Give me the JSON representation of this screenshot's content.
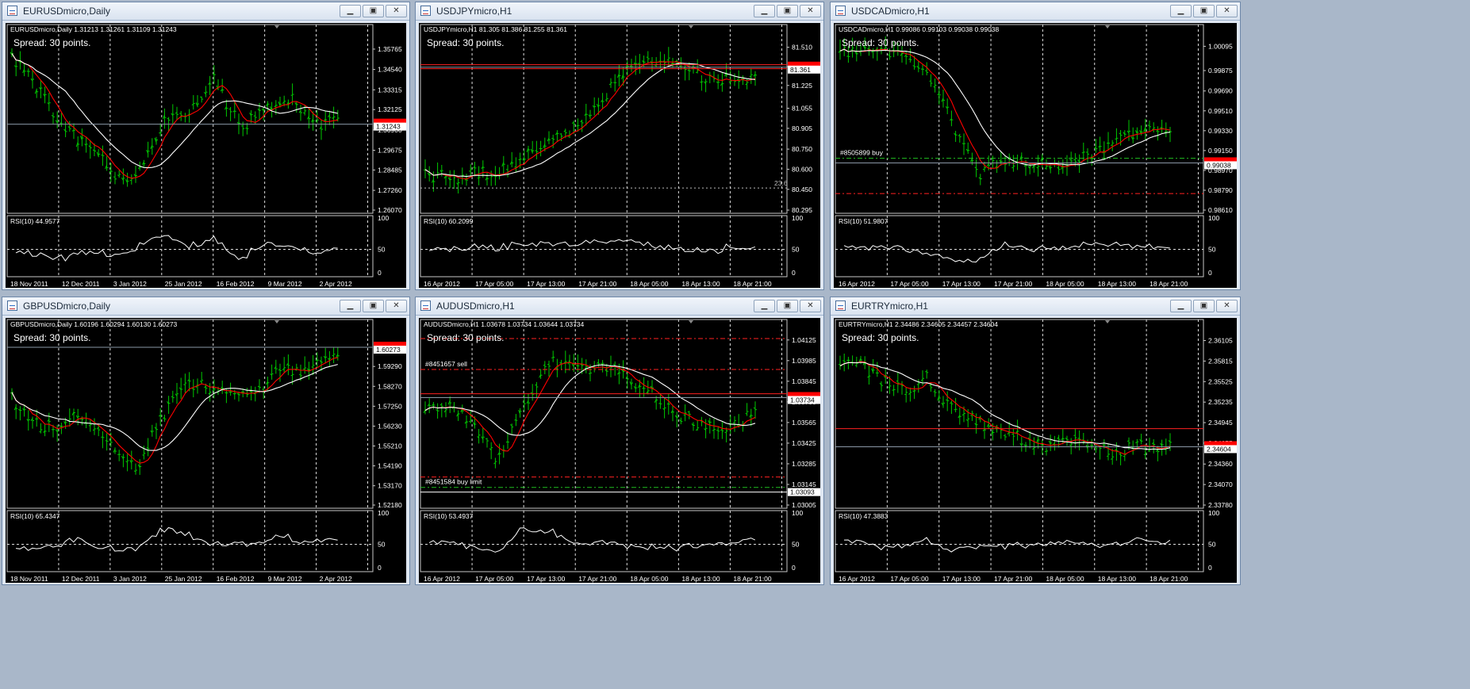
{
  "common": {
    "spread_text": "Spread: 30 points.",
    "rsi_levels": [
      "100",
      "50",
      "0"
    ],
    "window_buttons": [
      "minimize-icon",
      "restore-icon",
      "close-icon"
    ],
    "colors": {
      "bar": "#00c800",
      "fast_ma": "#ff0000",
      "slow_ma": "#ffffff",
      "grid": "#c8c8c8",
      "background": "#000000",
      "price_label_bg": "#ffffff",
      "marker_bg": "#ff0000"
    }
  },
  "windows": [
    {
      "id": "eurusd",
      "title": "EURUSDmicro,Daily",
      "header": "EURUSDmicro,Daily  1.31213 1.31261 1.31109 1.31243",
      "price_ticks": [
        "1.35765",
        "1.34540",
        "1.33315",
        "1.32125",
        "1.30900",
        "1.29675",
        "1.28485",
        "1.27260",
        "1.26070"
      ],
      "price_range": [
        1.2607,
        1.36765
      ],
      "current_price_label": "1.31243",
      "current_price": 1.31243,
      "rsi_label": "RSI(10) 44.9577",
      "time_labels": [
        "18 Nov 2011",
        "12 Dec 2011",
        "3 Jan 2012",
        "25 Jan 2012",
        "16 Feb 2012",
        "9 Mar 2012",
        "2 Apr 2012"
      ],
      "marker_label": "",
      "level_labels": [],
      "fib_label": "",
      "seed": 11
    },
    {
      "id": "usdjpy",
      "title": "USDJPYmicro,H1",
      "header": "USDJPYmicro,H1  81.305 81.386 81.255 81.361",
      "price_ticks": [
        "81.510",
        "81.365",
        "81.225",
        "81.055",
        "80.905",
        "80.750",
        "80.600",
        "80.450",
        "80.295"
      ],
      "price_range": [
        80.295,
        81.62
      ],
      "current_price_label": "81.361",
      "current_price": 81.361,
      "rsi_label": "RSI(10) 60.2099",
      "time_labels": [
        "16 Apr 2012",
        "17 Apr 05:00",
        "17 Apr 13:00",
        "17 Apr 21:00",
        "18 Apr 05:00",
        "18 Apr 13:00",
        "18 Apr 21:00"
      ],
      "marker_label": "",
      "level_labels": [],
      "fib_label": "23.6",
      "seed": 23
    },
    {
      "id": "usdcad",
      "title": "USDCADmicro,H1",
      "header": "USDCADmicro,H1  0.99086 0.99103 0.99038 0.99038",
      "price_ticks": [
        "1.00095",
        "0.99875",
        "0.99690",
        "0.99510",
        "0.99330",
        "0.99150",
        "0.98970",
        "0.98790",
        "0.98610"
      ],
      "price_range": [
        0.9861,
        1.0022
      ],
      "current_price_label": "0.99038",
      "current_price": 0.99038,
      "rsi_label": "RSI(10) 51.9807",
      "time_labels": [
        "16 Apr 2012",
        "17 Apr 05:00",
        "17 Apr 13:00",
        "17 Apr 21:00",
        "18 Apr 05:00",
        "18 Apr 13:00",
        "18 Apr 21:00"
      ],
      "marker_label": "",
      "level_labels": [
        "#8505899 buy"
      ],
      "fib_label": "",
      "seed": 37
    },
    {
      "id": "gbpusd",
      "title": "GBPUSDmicro,Daily",
      "header": "GBPUSDmicro,Daily  1.60196 1.60294 1.60130 1.60273",
      "price_ticks": [
        "1.59290",
        "1.58270",
        "1.57250",
        "1.56230",
        "1.55210",
        "1.54190",
        "1.53170",
        "1.52180"
      ],
      "price_range": [
        1.5218,
        1.6129
      ],
      "current_price_label": "1.60273",
      "current_price": 1.60273,
      "rsi_label": "RSI(10) 65.4347",
      "time_labels": [
        "18 Nov 2011",
        "12 Dec 2011",
        "3 Jan 2012",
        "25 Jan 2012",
        "16 Feb 2012",
        "9 Mar 2012",
        "2 Apr 2012"
      ],
      "marker_label": "",
      "level_labels": [],
      "fib_label": "",
      "seed": 41
    },
    {
      "id": "audusd",
      "title": "AUDUSDmicro,H1",
      "header": "AUDUSDmicro,H1  1.03678 1.03734 1.03644 1.03734",
      "price_ticks": [
        "1.04125",
        "1.03985",
        "1.03845",
        "1.03705",
        "1.03565",
        "1.03425",
        "1.03285",
        "1.03145",
        "1.03005"
      ],
      "price_range": [
        1.03005,
        1.0421
      ],
      "current_price_label": "1.03734",
      "current_price": 1.03734,
      "rsi_label": "RSI(10) 53.4937",
      "time_labels": [
        "16 Apr 2012",
        "17 Apr 05:00",
        "17 Apr 13:00",
        "17 Apr 21:00",
        "18 Apr 05:00",
        "18 Apr 13:00",
        "18 Apr 21:00"
      ],
      "marker_label": "1.03093",
      "level_labels": [
        "#8451657 sell",
        "#8451584 buy limit"
      ],
      "fib_label": "",
      "seed": 53
    },
    {
      "id": "eurtry",
      "title": "EURTRYmicro,H1",
      "header": "EURTRYmicro,H1  2.34486 2.34605 2.34457 2.34604",
      "price_ticks": [
        "2.36105",
        "2.35815",
        "2.35525",
        "2.35235",
        "2.34945",
        "2.34655",
        "2.34360",
        "2.34070",
        "2.33780"
      ],
      "price_range": [
        2.3378,
        2.3629
      ],
      "current_price_label": "2.34604",
      "current_price": 2.34604,
      "rsi_label": "RSI(10) 47.3883",
      "time_labels": [
        "16 Apr 2012",
        "17 Apr 05:00",
        "17 Apr 13:00",
        "17 Apr 21:00",
        "18 Apr 05:00",
        "18 Apr 13:00",
        "18 Apr 21:00"
      ],
      "marker_label": "",
      "level_labels": [],
      "fib_label": "",
      "seed": 67
    }
  ]
}
